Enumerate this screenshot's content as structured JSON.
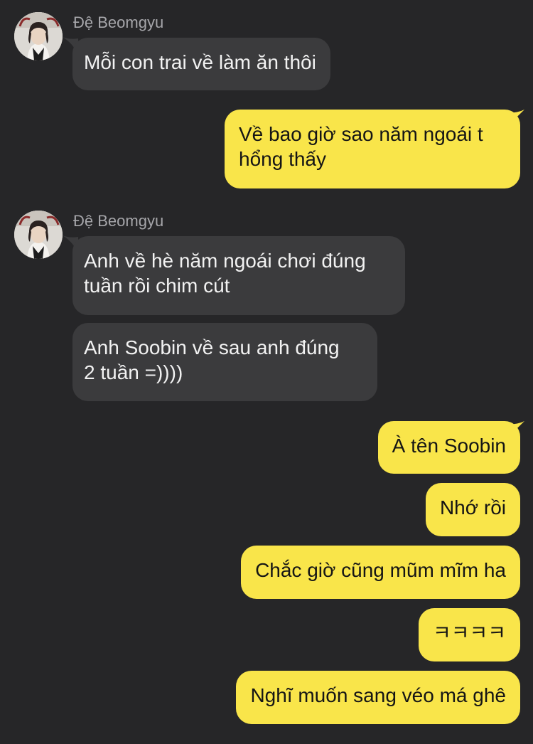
{
  "contact": {
    "name": "Đệ Beomgyu",
    "avatar_icon": "profile-photo-icon"
  },
  "colors": {
    "background": "#262628",
    "incoming_bubble": "#3b3b3d",
    "outgoing_bubble": "#f9e54a",
    "name_text": "#a6a6aa"
  },
  "messages": {
    "m1": "Mỗi con trai về làm ăn thôi",
    "m2": "Về bao giờ sao năm ngoái t\nhổng thấy",
    "m3": "Anh về hè năm ngoái chơi đúng\ntuần rồi chim cút",
    "m4": "Anh Soobin về sau anh đúng\n2 tuần =))))",
    "m5": "À tên Soobin",
    "m6": "Nhớ rồi",
    "m7": "Chắc giờ cũng mũm mĩm ha",
    "m8": "ㅋㅋㅋㅋ",
    "m9": "Nghĩ muốn sang véo má ghê"
  }
}
